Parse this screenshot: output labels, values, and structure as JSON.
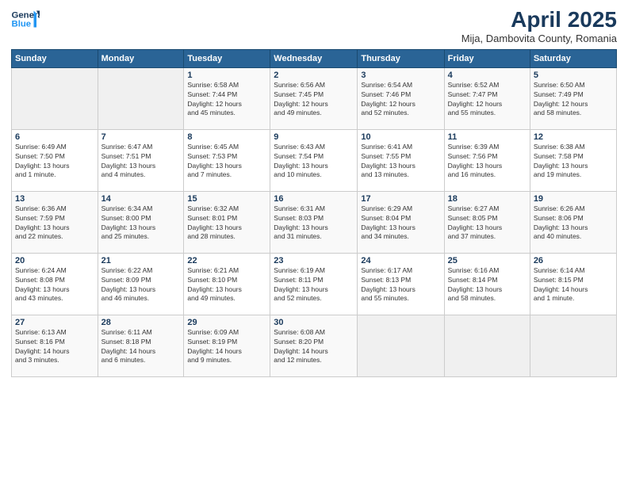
{
  "header": {
    "logo_line1": "General",
    "logo_line2": "Blue",
    "month_title": "April 2025",
    "subtitle": "Mija, Dambovita County, Romania"
  },
  "days_of_week": [
    "Sunday",
    "Monday",
    "Tuesday",
    "Wednesday",
    "Thursday",
    "Friday",
    "Saturday"
  ],
  "weeks": [
    [
      {
        "day": "",
        "details": ""
      },
      {
        "day": "",
        "details": ""
      },
      {
        "day": "1",
        "details": "Sunrise: 6:58 AM\nSunset: 7:44 PM\nDaylight: 12 hours\nand 45 minutes."
      },
      {
        "day": "2",
        "details": "Sunrise: 6:56 AM\nSunset: 7:45 PM\nDaylight: 12 hours\nand 49 minutes."
      },
      {
        "day": "3",
        "details": "Sunrise: 6:54 AM\nSunset: 7:46 PM\nDaylight: 12 hours\nand 52 minutes."
      },
      {
        "day": "4",
        "details": "Sunrise: 6:52 AM\nSunset: 7:47 PM\nDaylight: 12 hours\nand 55 minutes."
      },
      {
        "day": "5",
        "details": "Sunrise: 6:50 AM\nSunset: 7:49 PM\nDaylight: 12 hours\nand 58 minutes."
      }
    ],
    [
      {
        "day": "6",
        "details": "Sunrise: 6:49 AM\nSunset: 7:50 PM\nDaylight: 13 hours\nand 1 minute."
      },
      {
        "day": "7",
        "details": "Sunrise: 6:47 AM\nSunset: 7:51 PM\nDaylight: 13 hours\nand 4 minutes."
      },
      {
        "day": "8",
        "details": "Sunrise: 6:45 AM\nSunset: 7:53 PM\nDaylight: 13 hours\nand 7 minutes."
      },
      {
        "day": "9",
        "details": "Sunrise: 6:43 AM\nSunset: 7:54 PM\nDaylight: 13 hours\nand 10 minutes."
      },
      {
        "day": "10",
        "details": "Sunrise: 6:41 AM\nSunset: 7:55 PM\nDaylight: 13 hours\nand 13 minutes."
      },
      {
        "day": "11",
        "details": "Sunrise: 6:39 AM\nSunset: 7:56 PM\nDaylight: 13 hours\nand 16 minutes."
      },
      {
        "day": "12",
        "details": "Sunrise: 6:38 AM\nSunset: 7:58 PM\nDaylight: 13 hours\nand 19 minutes."
      }
    ],
    [
      {
        "day": "13",
        "details": "Sunrise: 6:36 AM\nSunset: 7:59 PM\nDaylight: 13 hours\nand 22 minutes."
      },
      {
        "day": "14",
        "details": "Sunrise: 6:34 AM\nSunset: 8:00 PM\nDaylight: 13 hours\nand 25 minutes."
      },
      {
        "day": "15",
        "details": "Sunrise: 6:32 AM\nSunset: 8:01 PM\nDaylight: 13 hours\nand 28 minutes."
      },
      {
        "day": "16",
        "details": "Sunrise: 6:31 AM\nSunset: 8:03 PM\nDaylight: 13 hours\nand 31 minutes."
      },
      {
        "day": "17",
        "details": "Sunrise: 6:29 AM\nSunset: 8:04 PM\nDaylight: 13 hours\nand 34 minutes."
      },
      {
        "day": "18",
        "details": "Sunrise: 6:27 AM\nSunset: 8:05 PM\nDaylight: 13 hours\nand 37 minutes."
      },
      {
        "day": "19",
        "details": "Sunrise: 6:26 AM\nSunset: 8:06 PM\nDaylight: 13 hours\nand 40 minutes."
      }
    ],
    [
      {
        "day": "20",
        "details": "Sunrise: 6:24 AM\nSunset: 8:08 PM\nDaylight: 13 hours\nand 43 minutes."
      },
      {
        "day": "21",
        "details": "Sunrise: 6:22 AM\nSunset: 8:09 PM\nDaylight: 13 hours\nand 46 minutes."
      },
      {
        "day": "22",
        "details": "Sunrise: 6:21 AM\nSunset: 8:10 PM\nDaylight: 13 hours\nand 49 minutes."
      },
      {
        "day": "23",
        "details": "Sunrise: 6:19 AM\nSunset: 8:11 PM\nDaylight: 13 hours\nand 52 minutes."
      },
      {
        "day": "24",
        "details": "Sunrise: 6:17 AM\nSunset: 8:13 PM\nDaylight: 13 hours\nand 55 minutes."
      },
      {
        "day": "25",
        "details": "Sunrise: 6:16 AM\nSunset: 8:14 PM\nDaylight: 13 hours\nand 58 minutes."
      },
      {
        "day": "26",
        "details": "Sunrise: 6:14 AM\nSunset: 8:15 PM\nDaylight: 14 hours\nand 1 minute."
      }
    ],
    [
      {
        "day": "27",
        "details": "Sunrise: 6:13 AM\nSunset: 8:16 PM\nDaylight: 14 hours\nand 3 minutes."
      },
      {
        "day": "28",
        "details": "Sunrise: 6:11 AM\nSunset: 8:18 PM\nDaylight: 14 hours\nand 6 minutes."
      },
      {
        "day": "29",
        "details": "Sunrise: 6:09 AM\nSunset: 8:19 PM\nDaylight: 14 hours\nand 9 minutes."
      },
      {
        "day": "30",
        "details": "Sunrise: 6:08 AM\nSunset: 8:20 PM\nDaylight: 14 hours\nand 12 minutes."
      },
      {
        "day": "",
        "details": ""
      },
      {
        "day": "",
        "details": ""
      },
      {
        "day": "",
        "details": ""
      }
    ]
  ]
}
